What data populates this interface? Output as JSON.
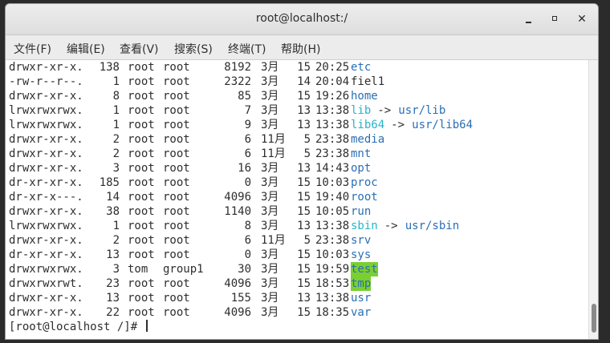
{
  "window": {
    "title": "root@localhost:/"
  },
  "window_buttons": {
    "min": "minimize-icon",
    "max": "maximize-icon",
    "close": "close-icon"
  },
  "menu": [
    {
      "label": "文件(F)"
    },
    {
      "label": "编辑(E)"
    },
    {
      "label": "查看(V)"
    },
    {
      "label": "搜索(S)"
    },
    {
      "label": "终端(T)"
    },
    {
      "label": "帮助(H)"
    }
  ],
  "colors": {
    "dir": "#2a6fb5",
    "link": "#27b5c9",
    "highlight_bg": "#7bcf2f",
    "text": "#2e2e2e"
  },
  "listing": [
    {
      "perm": "drwxr-xr-x.",
      "links": "138",
      "owner": "root",
      "group": "root",
      "size": "8192",
      "month": "3月",
      "day": "15",
      "time": "20:25",
      "name": "etc",
      "type": "dir",
      "arrow": "",
      "target": ""
    },
    {
      "perm": "-rw-r--r--.",
      "links": "1",
      "owner": "root",
      "group": "root",
      "size": "2322",
      "month": "3月",
      "day": "14",
      "time": "20:04",
      "name": "fiel1",
      "type": "file",
      "arrow": "",
      "target": ""
    },
    {
      "perm": "drwxr-xr-x.",
      "links": "8",
      "owner": "root",
      "group": "root",
      "size": "85",
      "month": "3月",
      "day": "15",
      "time": "19:26",
      "name": "home",
      "type": "dir",
      "arrow": "",
      "target": ""
    },
    {
      "perm": "lrwxrwxrwx.",
      "links": "1",
      "owner": "root",
      "group": "root",
      "size": "7",
      "month": "3月",
      "day": "13",
      "time": "13:38",
      "name": "lib",
      "type": "link",
      "arrow": "->",
      "target": "usr/lib"
    },
    {
      "perm": "lrwxrwxrwx.",
      "links": "1",
      "owner": "root",
      "group": "root",
      "size": "9",
      "month": "3月",
      "day": "13",
      "time": "13:38",
      "name": "lib64",
      "type": "link",
      "arrow": "->",
      "target": "usr/lib64"
    },
    {
      "perm": "drwxr-xr-x.",
      "links": "2",
      "owner": "root",
      "group": "root",
      "size": "6",
      "month": "11月",
      "day": "5",
      "time": "23:38",
      "name": "media",
      "type": "dir",
      "arrow": "",
      "target": ""
    },
    {
      "perm": "drwxr-xr-x.",
      "links": "2",
      "owner": "root",
      "group": "root",
      "size": "6",
      "month": "11月",
      "day": "5",
      "time": "23:38",
      "name": "mnt",
      "type": "dir",
      "arrow": "",
      "target": ""
    },
    {
      "perm": "drwxr-xr-x.",
      "links": "3",
      "owner": "root",
      "group": "root",
      "size": "16",
      "month": "3月",
      "day": "13",
      "time": "14:43",
      "name": "opt",
      "type": "dir",
      "arrow": "",
      "target": ""
    },
    {
      "perm": "dr-xr-xr-x.",
      "links": "185",
      "owner": "root",
      "group": "root",
      "size": "0",
      "month": "3月",
      "day": "15",
      "time": "10:03",
      "name": "proc",
      "type": "dir",
      "arrow": "",
      "target": ""
    },
    {
      "perm": "dr-xr-x---.",
      "links": "14",
      "owner": "root",
      "group": "root",
      "size": "4096",
      "month": "3月",
      "day": "15",
      "time": "19:40",
      "name": "root",
      "type": "dir",
      "arrow": "",
      "target": ""
    },
    {
      "perm": "drwxr-xr-x.",
      "links": "38",
      "owner": "root",
      "group": "root",
      "size": "1140",
      "month": "3月",
      "day": "15",
      "time": "10:05",
      "name": "run",
      "type": "dir",
      "arrow": "",
      "target": ""
    },
    {
      "perm": "lrwxrwxrwx.",
      "links": "1",
      "owner": "root",
      "group": "root",
      "size": "8",
      "month": "3月",
      "day": "13",
      "time": "13:38",
      "name": "sbin",
      "type": "link",
      "arrow": "->",
      "target": "usr/sbin"
    },
    {
      "perm": "drwxr-xr-x.",
      "links": "2",
      "owner": "root",
      "group": "root",
      "size": "6",
      "month": "11月",
      "day": "5",
      "time": "23:38",
      "name": "srv",
      "type": "dir",
      "arrow": "",
      "target": ""
    },
    {
      "perm": "dr-xr-xr-x.",
      "links": "13",
      "owner": "root",
      "group": "root",
      "size": "0",
      "month": "3月",
      "day": "15",
      "time": "10:03",
      "name": "sys",
      "type": "dir",
      "arrow": "",
      "target": ""
    },
    {
      "perm": "drwxrwxrwx.",
      "links": "3",
      "owner": "tom",
      "group": "group1",
      "size": "30",
      "month": "3月",
      "day": "15",
      "time": "19:59",
      "name": "test",
      "type": "highlight",
      "arrow": "",
      "target": ""
    },
    {
      "perm": "drwxrwxrwt.",
      "links": "23",
      "owner": "root",
      "group": "root",
      "size": "4096",
      "month": "3月",
      "day": "15",
      "time": "18:53",
      "name": "tmp",
      "type": "highlight",
      "arrow": "",
      "target": ""
    },
    {
      "perm": "drwxr-xr-x.",
      "links": "13",
      "owner": "root",
      "group": "root",
      "size": "155",
      "month": "3月",
      "day": "13",
      "time": "13:38",
      "name": "usr",
      "type": "dir",
      "arrow": "",
      "target": ""
    },
    {
      "perm": "drwxr-xr-x.",
      "links": "22",
      "owner": "root",
      "group": "root",
      "size": "4096",
      "month": "3月",
      "day": "15",
      "time": "18:35",
      "name": "var",
      "type": "dir",
      "arrow": "",
      "target": ""
    }
  ],
  "prompt": "[root@localhost /]# "
}
